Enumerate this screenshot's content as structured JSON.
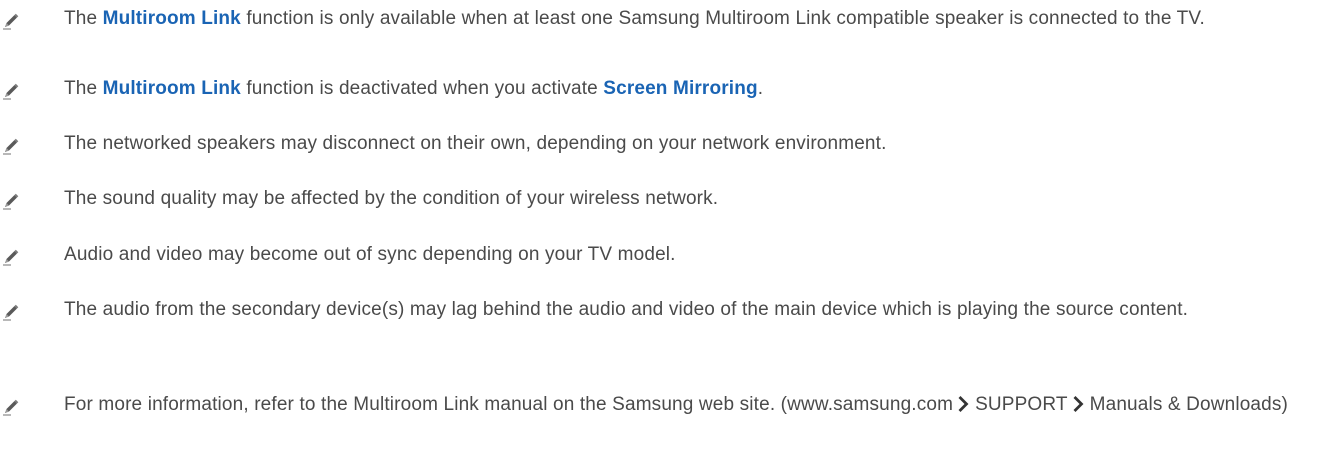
{
  "colors": {
    "body_text": "#4a4a4a",
    "keyword_blue": "#1a64b4",
    "note_icon": "#555555"
  },
  "notes": [
    {
      "icon": "pencil-note-icon",
      "pre": "The ",
      "kw1": "Multiroom Link",
      "post": " function is only available when at least one Samsung Multiroom Link compatible speaker is connected to the TV."
    },
    {
      "icon": "pencil-note-icon",
      "pre": "The ",
      "kw1": "Multiroom Link",
      "mid": " function is deactivated when you activate ",
      "kw2": "Screen Mirroring",
      "post": "."
    },
    {
      "icon": "pencil-note-icon",
      "text": "The networked speakers may disconnect on their own, depending on your network environment."
    },
    {
      "icon": "pencil-note-icon",
      "text": "The sound quality may be affected by the condition of your wireless network."
    },
    {
      "icon": "pencil-note-icon",
      "text": "Audio and video may become out of sync depending on your TV model."
    },
    {
      "icon": "pencil-note-icon",
      "text": "The audio from the secondary device(s) may lag behind the audio and video of the main device which is playing the source content."
    },
    {
      "icon": "pencil-note-icon",
      "pre": "For more information, refer to the Multiroom Link manual on the Samsung web site. (www.samsung.com",
      "step1": "SUPPORT",
      "step2": "Manuals & Downloads)",
      "separator_icon": "chevron-right-icon"
    }
  ]
}
